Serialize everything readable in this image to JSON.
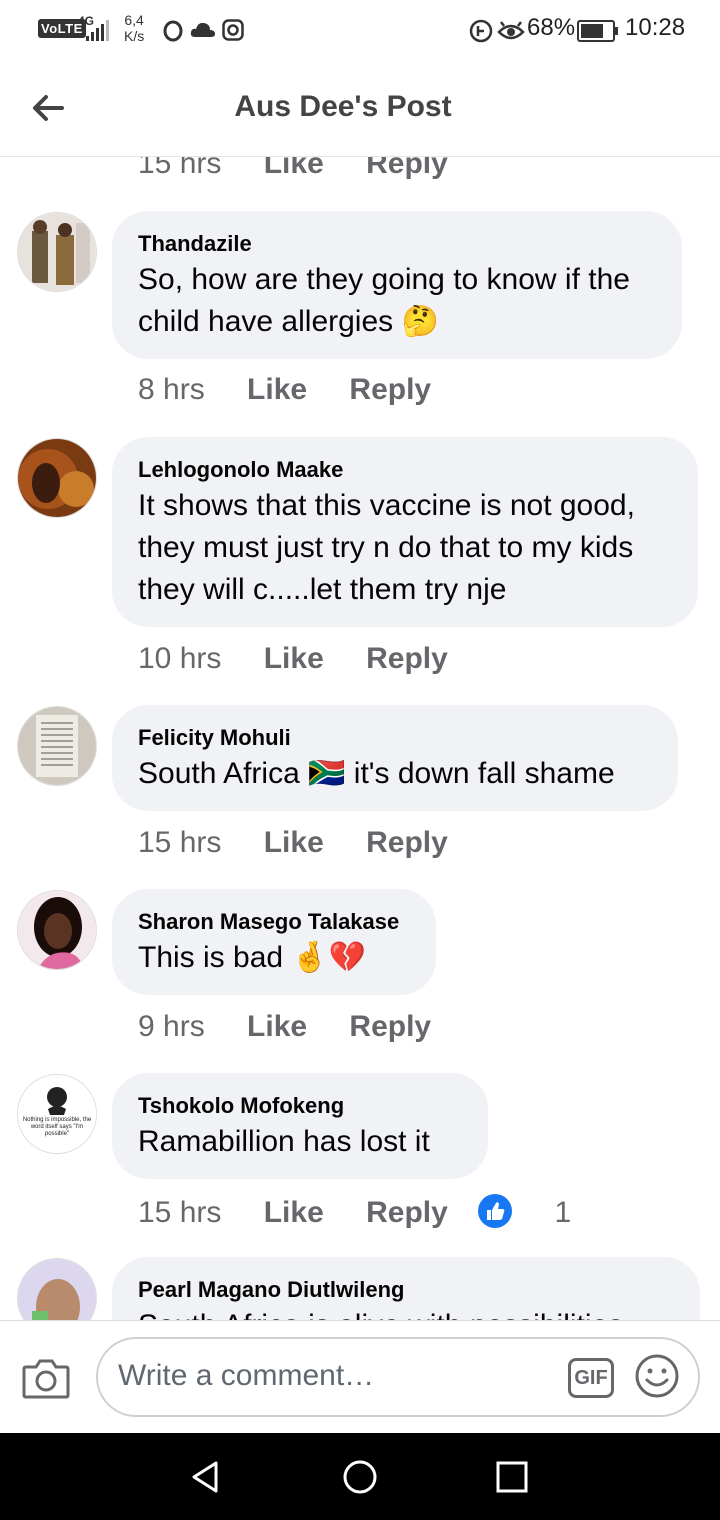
{
  "status_bar": {
    "network_badge": "VoLTE",
    "signal_label": "4G",
    "speed_value": "6,4",
    "speed_unit": "K/s",
    "battery": "68%",
    "time": "10:28"
  },
  "header": {
    "title": "Aus Dee's Post",
    "back_icon": "arrow-left-icon"
  },
  "previous_meta": {
    "time": "15 hrs",
    "like": "Like",
    "reply": "Reply"
  },
  "comments": [
    {
      "author": "Thandazile",
      "text": "So, how are they going to know if the child have allergies 🤔",
      "time": "8 hrs",
      "like": "Like",
      "reply": "Reply"
    },
    {
      "author": "Lehlogonolo Maake",
      "text": "It shows that this vaccine is not good, they must just try n do that to my kids they will c.....let them try nje",
      "time": "10 hrs",
      "like": "Like",
      "reply": "Reply"
    },
    {
      "author": "Felicity Mohuli",
      "text": "South Africa 🇿🇦 it's down fall shame",
      "time": "15 hrs",
      "like": "Like",
      "reply": "Reply"
    },
    {
      "author": "Sharon Masego Talakase",
      "text": "This is bad 🤞💔",
      "time": "9 hrs",
      "like": "Like",
      "reply": "Reply"
    },
    {
      "author": "Tshokolo Mofokeng",
      "text": "Ramabillion has lost it",
      "time": "15 hrs",
      "like": "Like",
      "reply": "Reply",
      "reactions": "1"
    },
    {
      "author": "Pearl Magano Diutlwileng",
      "text": "South Africa is alive with possibilities"
    }
  ],
  "avatar_4_caption": "Nothing is impossible, the word itself says \"I'm possible\"",
  "composer": {
    "placeholder": "Write a comment…",
    "gif_label": "GIF"
  },
  "colors": {
    "accent": "#1877f2",
    "bubble": "#f0f2f5",
    "meta": "#65676b"
  }
}
